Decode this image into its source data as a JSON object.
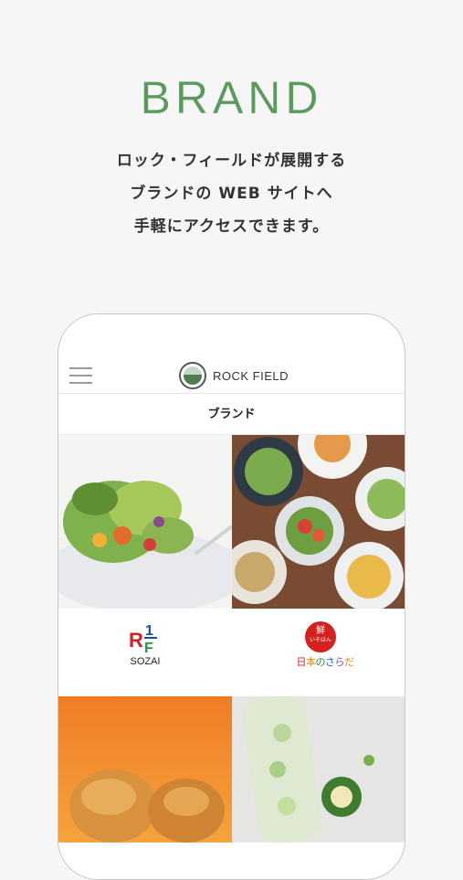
{
  "page": {
    "title": "BRAND",
    "intro_lines": [
      "ロック・フィールドが展開する",
      "ブランドの WEB サイトへ",
      "手軽にアクセスできます。"
    ]
  },
  "phone": {
    "header": {
      "logo_text": "ROCK FIELD",
      "menu_icon": "hamburger-menu-icon"
    },
    "subheader": "ブランド",
    "brands": [
      {
        "logo_text_top": "R1F",
        "caption": "SOZAI"
      },
      {
        "seal_text": "鮮",
        "seal_sub": "いそはん",
        "name": "日本のさらだ"
      }
    ]
  },
  "colors": {
    "accent_green": "#5a9a5e",
    "background": "#f6f6f6",
    "seal_red": "#d6201f"
  }
}
